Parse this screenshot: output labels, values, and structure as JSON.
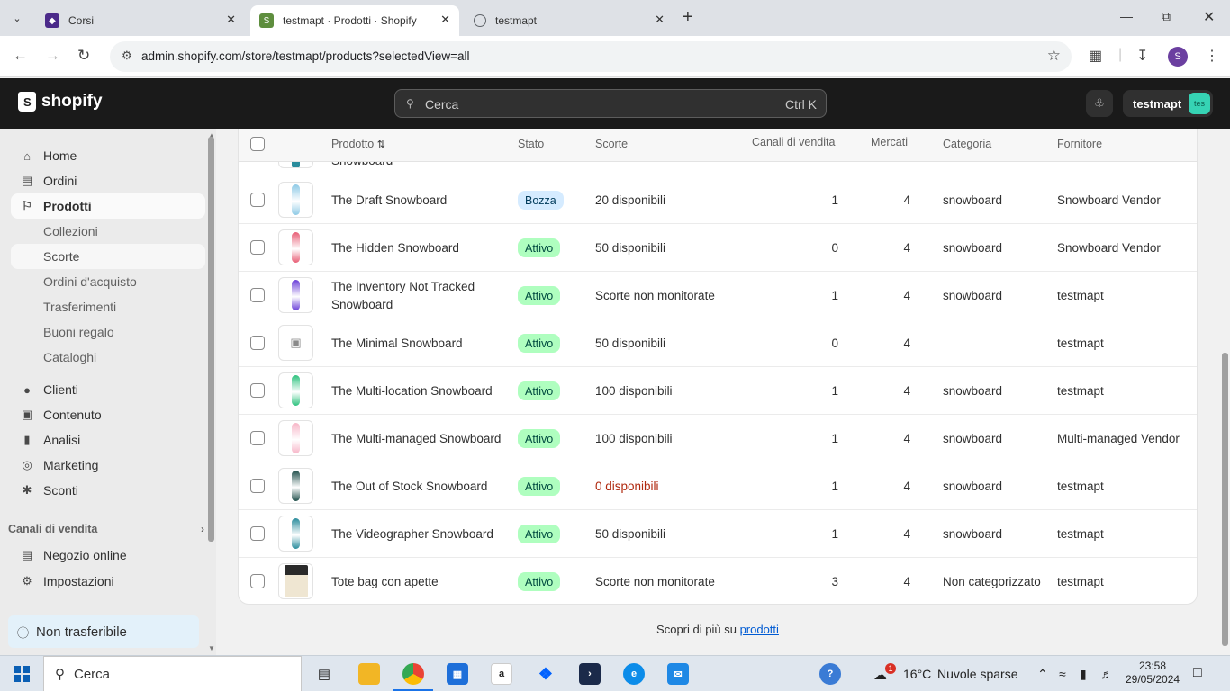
{
  "browser": {
    "tabs": [
      {
        "title": "Corsi",
        "icon": "course-site-icon",
        "color": "#4b2a8a"
      },
      {
        "title": "testmapt · Prodotti · Shopify",
        "icon": "shopify-icon",
        "color": "#5e8e3e"
      },
      {
        "title": "testmapt",
        "icon": "globe-icon",
        "color": "#5f6368"
      }
    ],
    "url": "admin.shopify.com/store/testmapt/products?selectedView=all",
    "profile_initial": "S"
  },
  "header": {
    "brand": "shopify",
    "search_placeholder": "Cerca",
    "search_shortcut": "Ctrl K",
    "store_name": "testmapt",
    "store_avatar": "tes"
  },
  "sidebar": {
    "items": [
      {
        "label": "Home",
        "icon": "home-icon"
      },
      {
        "label": "Ordini",
        "icon": "inbox-icon"
      },
      {
        "label": "Prodotti",
        "icon": "tag-icon"
      },
      {
        "label": "Collezioni"
      },
      {
        "label": "Scorte"
      },
      {
        "label": "Ordini d'acquisto"
      },
      {
        "label": "Trasferimenti"
      },
      {
        "label": "Buoni regalo"
      },
      {
        "label": "Cataloghi"
      },
      {
        "label": "Clienti",
        "icon": "person-icon"
      },
      {
        "label": "Contenuto",
        "icon": "content-icon"
      },
      {
        "label": "Analisi",
        "icon": "chart-icon"
      },
      {
        "label": "Marketing",
        "icon": "target-icon"
      },
      {
        "label": "Sconti",
        "icon": "discount-icon"
      }
    ],
    "section_label": "Canali di vendita",
    "online_store": "Negozio online",
    "settings": "Impostazioni",
    "notice": "Non trasferibile"
  },
  "table": {
    "headers": {
      "product": "Prodotto",
      "status": "Stato",
      "inventory": "Scorte",
      "channels": "Canali di vendita",
      "markets": "Mercati",
      "category": "Categoria",
      "vendor": "Fornitore"
    },
    "partial_row": {
      "name": "Snowboard"
    },
    "rows": [
      {
        "name": "The Draft Snowboard",
        "status": "Bozza",
        "inventory": "20 disponibili",
        "channels": "1",
        "markets": "4",
        "category": "snowboard",
        "vendor": "Snowboard Vendor",
        "thumb": "#8ecae6"
      },
      {
        "name": "The Hidden Snowboard",
        "status": "Attivo",
        "inventory": "50 disponibili",
        "channels": "0",
        "markets": "4",
        "category": "snowboard",
        "vendor": "Snowboard Vendor",
        "thumb": "#e85d75"
      },
      {
        "name": "The Inventory Not Tracked Snowboard",
        "status": "Attivo",
        "inventory": "Scorte non monitorate",
        "channels": "1",
        "markets": "4",
        "category": "snowboard",
        "vendor": "testmapt",
        "thumb": "#6a3fd8"
      },
      {
        "name": "The Minimal Snowboard",
        "status": "Attivo",
        "inventory": "50 disponibili",
        "channels": "0",
        "markets": "4",
        "category": "",
        "vendor": "testmapt",
        "thumb": "placeholder"
      },
      {
        "name": "The Multi-location Snowboard",
        "status": "Attivo",
        "inventory": "100 disponibili",
        "channels": "1",
        "markets": "4",
        "category": "snowboard",
        "vendor": "testmapt",
        "thumb": "#2ec27e"
      },
      {
        "name": "The Multi-managed Snowboard",
        "status": "Attivo",
        "inventory": "100 disponibili",
        "channels": "1",
        "markets": "4",
        "category": "snowboard",
        "vendor": "Multi-managed Vendor",
        "thumb": "#f7b6c8"
      },
      {
        "name": "The Out of Stock Snowboard",
        "status": "Attivo",
        "inventory": "0 disponibili",
        "channels": "1",
        "markets": "4",
        "category": "snowboard",
        "vendor": "testmapt",
        "thumb": "#1f4e4a"
      },
      {
        "name": "The Videographer Snowboard",
        "status": "Attivo",
        "inventory": "50 disponibili",
        "channels": "1",
        "markets": "4",
        "category": "snowboard",
        "vendor": "testmapt",
        "thumb": "#2a8c9c"
      },
      {
        "name": "Tote bag con apette",
        "status": "Attivo",
        "inventory": "Scorte non monitorate",
        "channels": "3",
        "markets": "4",
        "category": "Non categorizzato",
        "vendor": "testmapt",
        "thumb": "#efe6d2"
      }
    ]
  },
  "footer": {
    "text": "Scopri di più su",
    "link": "prodotti"
  },
  "taskbar": {
    "search": "Cerca",
    "weather_temp": "16°C",
    "weather_desc": "Nuvole sparse",
    "weather_badge": "1",
    "time": "23:58",
    "date": "29/05/2024"
  },
  "colors": {
    "active_badge": "#affebf",
    "draft_badge": "#d5ebff",
    "out_of_stock": "#b0290f",
    "shopify_header": "#1a1a1a"
  }
}
